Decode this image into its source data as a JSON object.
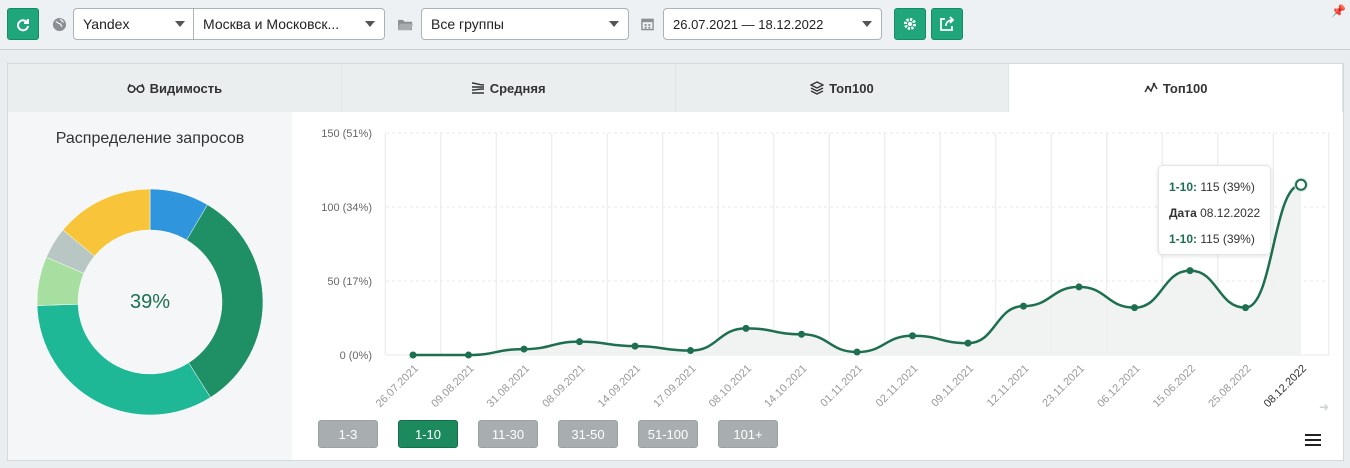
{
  "toolbar": {
    "search_engine": "Yandex",
    "region": "Москва и Московск...",
    "group": "Все группы",
    "date_range": "26.07.2021 — 18.12.2022"
  },
  "tabs": [
    {
      "label": "Видимость",
      "icon": "glasses-icon",
      "active": false
    },
    {
      "label": "Средняя",
      "icon": "lines-icon",
      "active": false
    },
    {
      "label": "Топ100",
      "icon": "layers-icon",
      "active": false
    },
    {
      "label": "Топ100",
      "icon": "chart-icon",
      "active": true
    }
  ],
  "donut": {
    "title": "Распределение запросов",
    "center_label": "39%",
    "colors": [
      "#2f95dc",
      "#1f8f66",
      "#1fb896",
      "#a7dfa0",
      "#b8c6c4",
      "#f8c53a"
    ],
    "shares": [
      0.085,
      0.325,
      0.335,
      0.07,
      0.045,
      0.14
    ]
  },
  "chart_data": {
    "type": "line",
    "x": [
      "26.07.2021",
      "09.08.2021",
      "31.08.2021",
      "08.09.2021",
      "14.09.2021",
      "17.09.2021",
      "08.10.2021",
      "14.10.2021",
      "01.11.2021",
      "02.11.2021",
      "09.11.2021",
      "12.11.2021",
      "23.11.2021",
      "06.12.2021",
      "15.06.2022",
      "25.08.2022",
      "08.12.2022"
    ],
    "series": [
      {
        "values": [
          0,
          0,
          4,
          9,
          6,
          3,
          18,
          14,
          2,
          13,
          8,
          33,
          46,
          32,
          57,
          32,
          115
        ],
        "color": "#1d6f4f"
      }
    ],
    "y_ticks": [
      "0 (0%)",
      "50 (17%)",
      "100 (34%)",
      "150 (51%)"
    ],
    "ylim": [
      0,
      150
    ],
    "grid": true
  },
  "tooltip": {
    "line1_key": "1-10:",
    "line1_val": "115 (39%)",
    "line2_key": "Дата",
    "line2_val": "08.12.2022",
    "line3_key": "1-10:",
    "line3_val": "115 (39%)"
  },
  "range_buttons": [
    {
      "label": "1-3",
      "active": false
    },
    {
      "label": "1-10",
      "active": true
    },
    {
      "label": "11-30",
      "active": false
    },
    {
      "label": "31-50",
      "active": false
    },
    {
      "label": "51-100",
      "active": false
    },
    {
      "label": "101+",
      "active": false
    }
  ]
}
